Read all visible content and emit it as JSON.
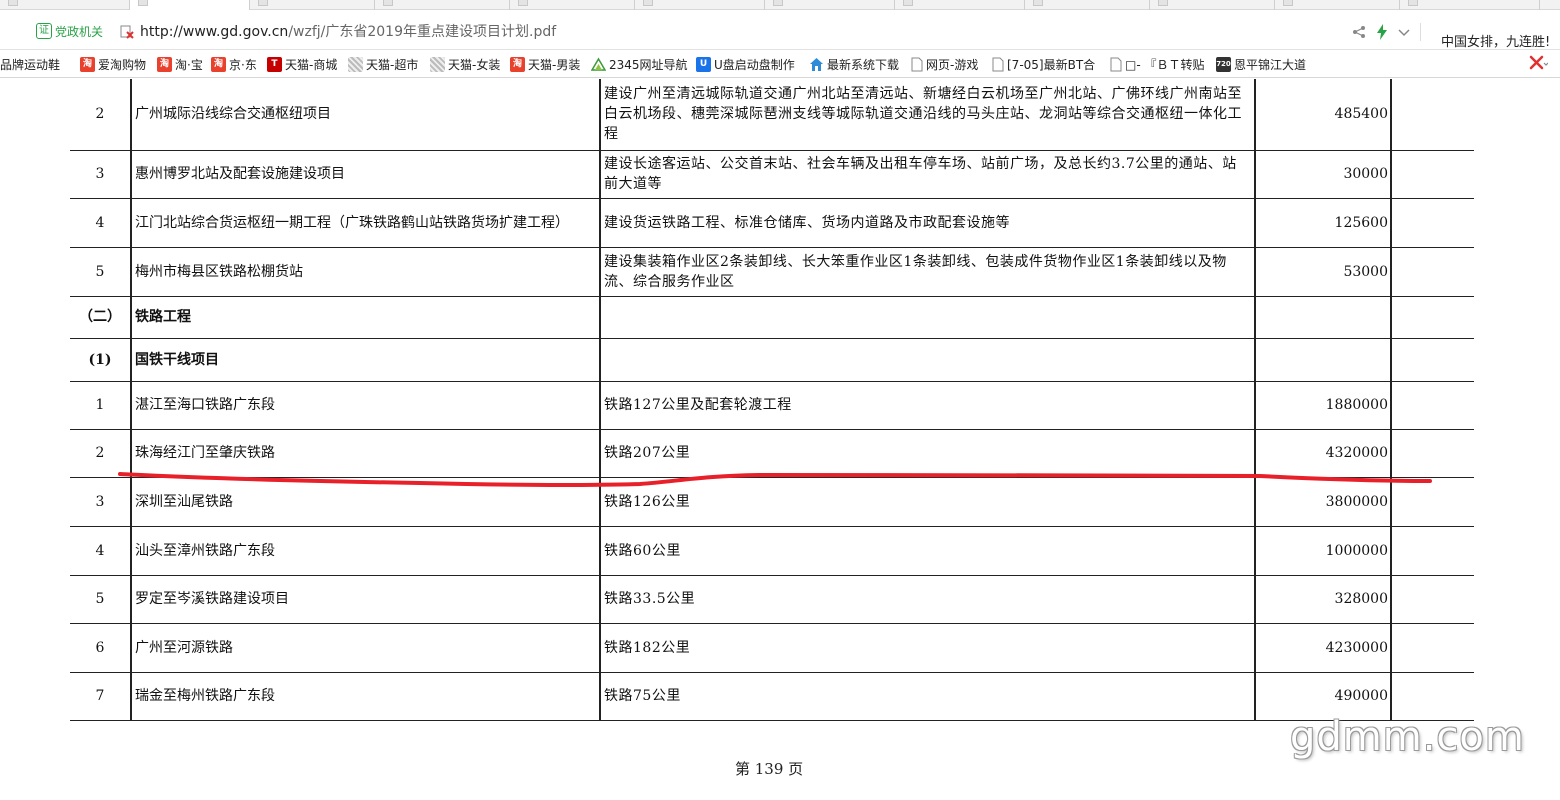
{
  "browser": {
    "site_badge": "党政机关",
    "url_domain": "http://www.gd.gov.cn",
    "url_path": "/wzfj/广东省2019年重点建设项目计划.pdf",
    "hot_news": "中国女排，九连胜!",
    "icons": [
      "share-icon",
      "lightning-icon",
      "chevron-down-icon"
    ]
  },
  "bookmarks": [
    {
      "label": "品牌运动鞋",
      "icon": "bookmark-icon"
    },
    {
      "label": "爱淘购物",
      "icon": "taobao-icon",
      "glyph": "淘"
    },
    {
      "label": "淘·宝",
      "icon": "taobao-icon",
      "glyph": "淘"
    },
    {
      "label": "京·东",
      "icon": "taobao-icon",
      "glyph": "淘"
    },
    {
      "label": "天猫-商城",
      "icon": "tmall-icon",
      "glyph": "T"
    },
    {
      "label": "天猫-超市",
      "icon": "grid-icon"
    },
    {
      "label": "天猫-女装",
      "icon": "grid-icon"
    },
    {
      "label": "天猫-男装",
      "icon": "taobao-icon",
      "glyph": "淘"
    },
    {
      "label": "2345网址导航",
      "icon": "2345-icon"
    },
    {
      "label": "U盘启动盘制作",
      "icon": "u-disk-icon",
      "glyph": "U"
    },
    {
      "label": "最新系统下载",
      "icon": "house-icon"
    },
    {
      "label": "网页-游戏",
      "icon": "page-icon"
    },
    {
      "label": "[7-05]最新BT合",
      "icon": "page-icon"
    },
    {
      "label": "□- 『ＢＴ转贴",
      "icon": "page-icon"
    },
    {
      "label": "恩平锦江大道",
      "icon": "720-icon",
      "glyph": "720"
    }
  ],
  "table": {
    "rows": [
      {
        "idx": "2",
        "name": "广州城际沿线综合交通枢纽项目",
        "desc": "建设广州至清远城际轨道交通广州北站至清远站、新塘经白云机场至广州北站、广佛环线广州南站至白云机场段、穗莞深城际琶洲支线等城际轨道交通沿线的马头庄站、龙洞站等综合交通枢纽一体化工程",
        "amount": "485400",
        "section": false
      },
      {
        "idx": "3",
        "name": "惠州博罗北站及配套设施建设项目",
        "desc": "建设长途客运站、公交首末站、社会车辆及出租车停车场、站前广场，及总长约3.7公里的通站、站前大道等",
        "amount": "30000",
        "section": false
      },
      {
        "idx": "4",
        "name": "江门北站综合货运枢纽一期工程（广珠铁路鹤山站铁路货场扩建工程）",
        "desc": "建设货运铁路工程、标准仓储库、货场内道路及市政配套设施等",
        "amount": "125600",
        "section": false
      },
      {
        "idx": "5",
        "name": "梅州市梅县区铁路松棚货站",
        "desc": "建设集装箱作业区2条装卸线、长大笨重作业区1条装卸线、包装成件货物作业区1条装卸线以及物流、综合服务作业区",
        "amount": "53000",
        "section": false
      },
      {
        "idx": "（二）",
        "name": "铁路工程",
        "desc": "",
        "amount": "",
        "section": true
      },
      {
        "idx": "(1)",
        "name": "国铁干线项目",
        "desc": "",
        "amount": "",
        "section": true
      },
      {
        "idx": "1",
        "name": "湛江至海口铁路广东段",
        "desc": "铁路127公里及配套轮渡工程",
        "amount": "1880000",
        "section": false
      },
      {
        "idx": "2",
        "name": "珠海经江门至肇庆铁路",
        "desc": "铁路207公里",
        "amount": "4320000",
        "section": false
      },
      {
        "idx": "3",
        "name": "深圳至汕尾铁路",
        "desc": "铁路126公里",
        "amount": "3800000",
        "section": false
      },
      {
        "idx": "4",
        "name": "汕头至漳州铁路广东段",
        "desc": "铁路60公里",
        "amount": "1000000",
        "section": false
      },
      {
        "idx": "5",
        "name": "罗定至岑溪铁路建设项目",
        "desc": "铁路33.5公里",
        "amount": "328000",
        "section": false
      },
      {
        "idx": "6",
        "name": "广州至河源铁路",
        "desc": "铁路182公里",
        "amount": "4230000",
        "section": false
      },
      {
        "idx": "7",
        "name": "瑞金至梅州铁路广东段",
        "desc": "铁路75公里",
        "amount": "490000",
        "section": false
      }
    ]
  },
  "page_number": "第 139 页",
  "watermark": "gdmm.com",
  "annotation": {
    "color": "#e8202a"
  }
}
